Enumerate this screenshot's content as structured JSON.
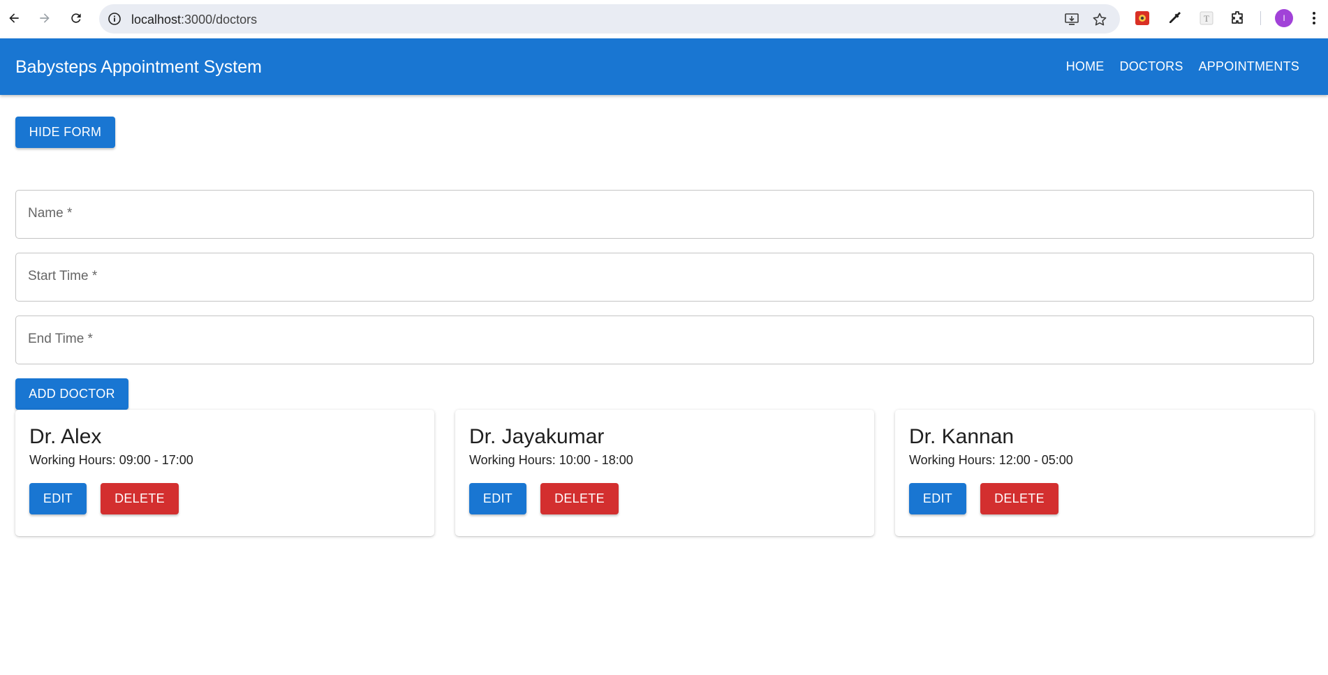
{
  "browser": {
    "url_host": "localhost",
    "url_path": ":3000/doctors",
    "profile_initial": "I"
  },
  "app": {
    "title": "Babysteps Appointment System",
    "nav": [
      "HOME",
      "DOCTORS",
      "APPOINTMENTS"
    ]
  },
  "form": {
    "toggle_label": "HIDE FORM",
    "name_placeholder": "Name *",
    "start_placeholder": "Start Time *",
    "end_placeholder": "End Time *",
    "submit_label": "ADD DOCTOR"
  },
  "doctors": [
    {
      "name": "Dr. Alex",
      "hours_label": "Working Hours: 09:00 - 17:00",
      "edit_label": "EDIT",
      "delete_label": "DELETE"
    },
    {
      "name": "Dr. Jayakumar",
      "hours_label": "Working Hours: 10:00 - 18:00",
      "edit_label": "EDIT",
      "delete_label": "DELETE"
    },
    {
      "name": "Dr. Kannan",
      "hours_label": "Working Hours: 12:00 - 05:00",
      "edit_label": "EDIT",
      "delete_label": "DELETE"
    }
  ],
  "colors": {
    "primary": "#1976d2",
    "danger": "#d32f2f",
    "profile": "#a142d8"
  },
  "icons": [
    "back-arrow-icon",
    "forward-arrow-icon",
    "reload-icon",
    "site-info-icon",
    "install-app-icon",
    "bookmark-star-icon",
    "extension-puzzle-icon",
    "eyedropper-icon",
    "font-extension-icon",
    "extensions-icon",
    "menu-kebab-icon"
  ]
}
